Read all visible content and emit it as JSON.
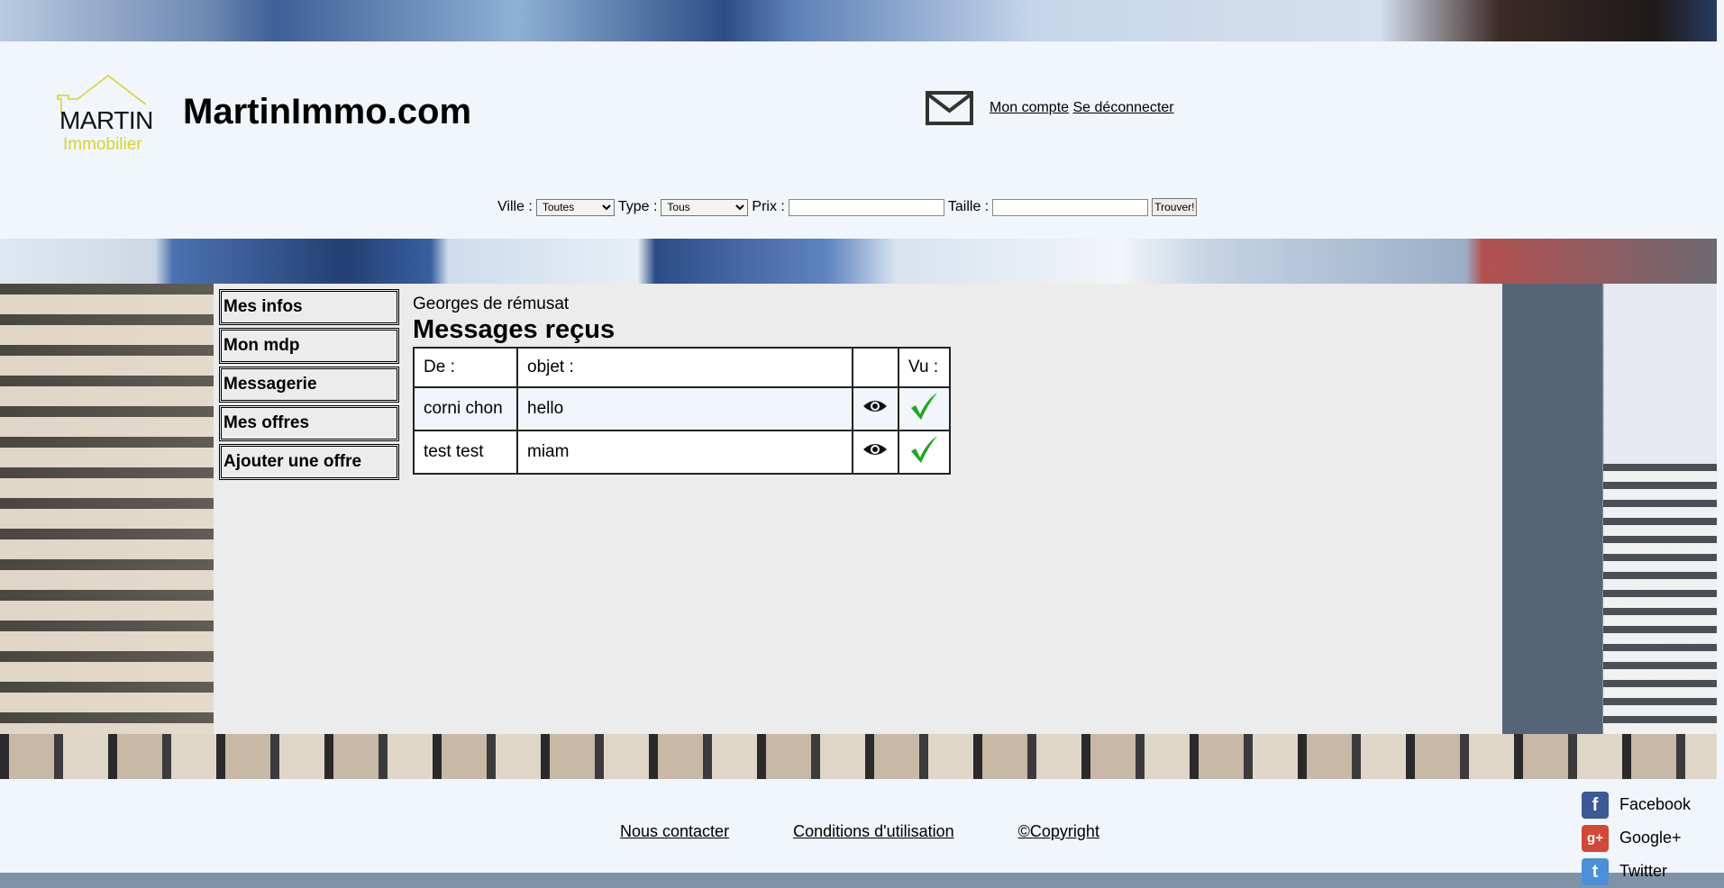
{
  "header": {
    "logo_name": "MARTIN",
    "logo_sub": "Immobilier",
    "site_title": "MartinImmo.com",
    "mail_icon": "envelope-icon",
    "account_link": "Mon compte",
    "logout_link": "Se déconnecter"
  },
  "search": {
    "ville_label": "Ville :",
    "ville_value": "Toutes",
    "type_label": "Type :",
    "type_value": "Tous",
    "prix_label": "Prix :",
    "prix_value": "",
    "taille_label": "Taille :",
    "taille_value": "",
    "submit_label": "Trouver!"
  },
  "sidebar": {
    "items": [
      {
        "label": "Mes infos"
      },
      {
        "label": "Mon mdp"
      },
      {
        "label": "Messagerie"
      },
      {
        "label": "Mes offres"
      },
      {
        "label": "Ajouter une offre"
      }
    ]
  },
  "main": {
    "user_name": "Georges de rémusat",
    "section_title": "Messages reçus",
    "table": {
      "headers": [
        "De :",
        "objet :",
        "",
        "Vu :"
      ],
      "rows": [
        {
          "from": "corni chon",
          "subject": "hello",
          "view_icon": "eye-icon",
          "seen": true,
          "seen_icon": "check-icon"
        },
        {
          "from": "test test",
          "subject": "miam",
          "view_icon": "eye-icon",
          "seen": true,
          "seen_icon": "check-icon"
        }
      ]
    }
  },
  "footer": {
    "links": [
      "Nous contacter",
      "Conditions d'utilisation",
      "©Copyright"
    ],
    "social": [
      {
        "label": "Facebook",
        "icon": "facebook-icon"
      },
      {
        "label": "Google+",
        "icon": "google-plus-icon"
      },
      {
        "label": "Twitter",
        "icon": "twitter-icon"
      }
    ]
  },
  "colors": {
    "header_bg": "#f0f6fc",
    "panel_bg": "#ececec",
    "logo_accent": "#d8d427",
    "check_green": "#1aaa1a"
  }
}
